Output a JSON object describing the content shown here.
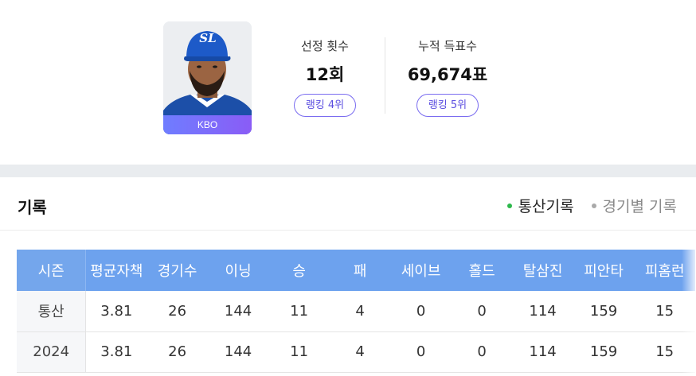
{
  "profile": {
    "league_label": "KBO",
    "team_logo_text": "SL",
    "stats": [
      {
        "label": "선정 횟수",
        "value": "12회",
        "rank": "랭킹 4위"
      },
      {
        "label": "누적 득표수",
        "value": "69,674표",
        "rank": "랭킹 5위"
      }
    ]
  },
  "records": {
    "title": "기록",
    "tabs": [
      {
        "label": "통산기록",
        "active": true
      },
      {
        "label": "경기별 기록",
        "active": false
      }
    ],
    "columns": [
      "시즌",
      "평균자책",
      "경기수",
      "이닝",
      "승",
      "패",
      "세이브",
      "홀드",
      "탈삼진",
      "피안타",
      "피홈런"
    ],
    "rows": [
      [
        "통산",
        "3.81",
        "26",
        "144",
        "11",
        "4",
        "0",
        "0",
        "114",
        "159",
        "15"
      ],
      [
        "2024",
        "3.81",
        "26",
        "144",
        "11",
        "4",
        "0",
        "0",
        "114",
        "159",
        "15"
      ]
    ]
  },
  "colors": {
    "table_header": "#6da2ee",
    "accent_purple": "#7a6cf0",
    "active_dot": "#2db84b",
    "section_divider": "#e9ecef"
  }
}
